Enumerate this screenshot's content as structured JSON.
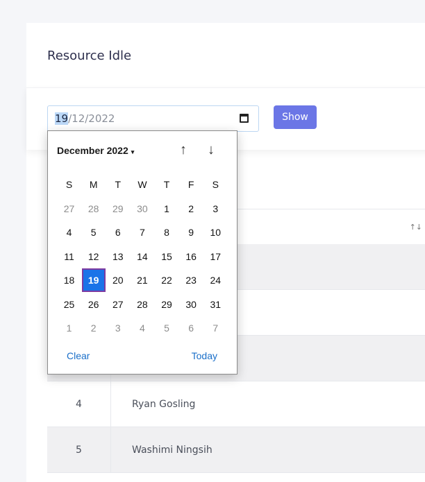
{
  "card": {
    "title": "Resource Idle"
  },
  "filter": {
    "date_day": "19",
    "date_rest": "/12/2022",
    "show_label": "Show"
  },
  "table": {
    "sort_glyph": "↑↓",
    "rows": [
      {
        "num": "",
        "name": ""
      },
      {
        "num": "",
        "name": ""
      },
      {
        "num": "",
        "name": ""
      },
      {
        "num": "4",
        "name": "Ryan Gosling"
      },
      {
        "num": "5",
        "name": "Washimi Ningsih"
      }
    ]
  },
  "calendar": {
    "month_label": "December 2022",
    "caret": "▾",
    "nav_up": "↑",
    "nav_down": "↓",
    "weekdays": [
      "S",
      "M",
      "T",
      "W",
      "T",
      "F",
      "S"
    ],
    "weeks": [
      [
        "27",
        "28",
        "29",
        "30",
        "1",
        "2",
        "3"
      ],
      [
        "4",
        "5",
        "6",
        "7",
        "8",
        "9",
        "10"
      ],
      [
        "11",
        "12",
        "13",
        "14",
        "15",
        "16",
        "17"
      ],
      [
        "18",
        "19",
        "20",
        "21",
        "22",
        "23",
        "24"
      ],
      [
        "25",
        "26",
        "27",
        "28",
        "29",
        "30",
        "31"
      ],
      [
        "1",
        "2",
        "3",
        "4",
        "5",
        "6",
        "7"
      ]
    ],
    "selected_day": "19",
    "clear_label": "Clear",
    "today_label": "Today"
  },
  "colors": {
    "accent": "#6b76e6",
    "selected": "#1a73e8",
    "link": "#1a6fc9"
  }
}
